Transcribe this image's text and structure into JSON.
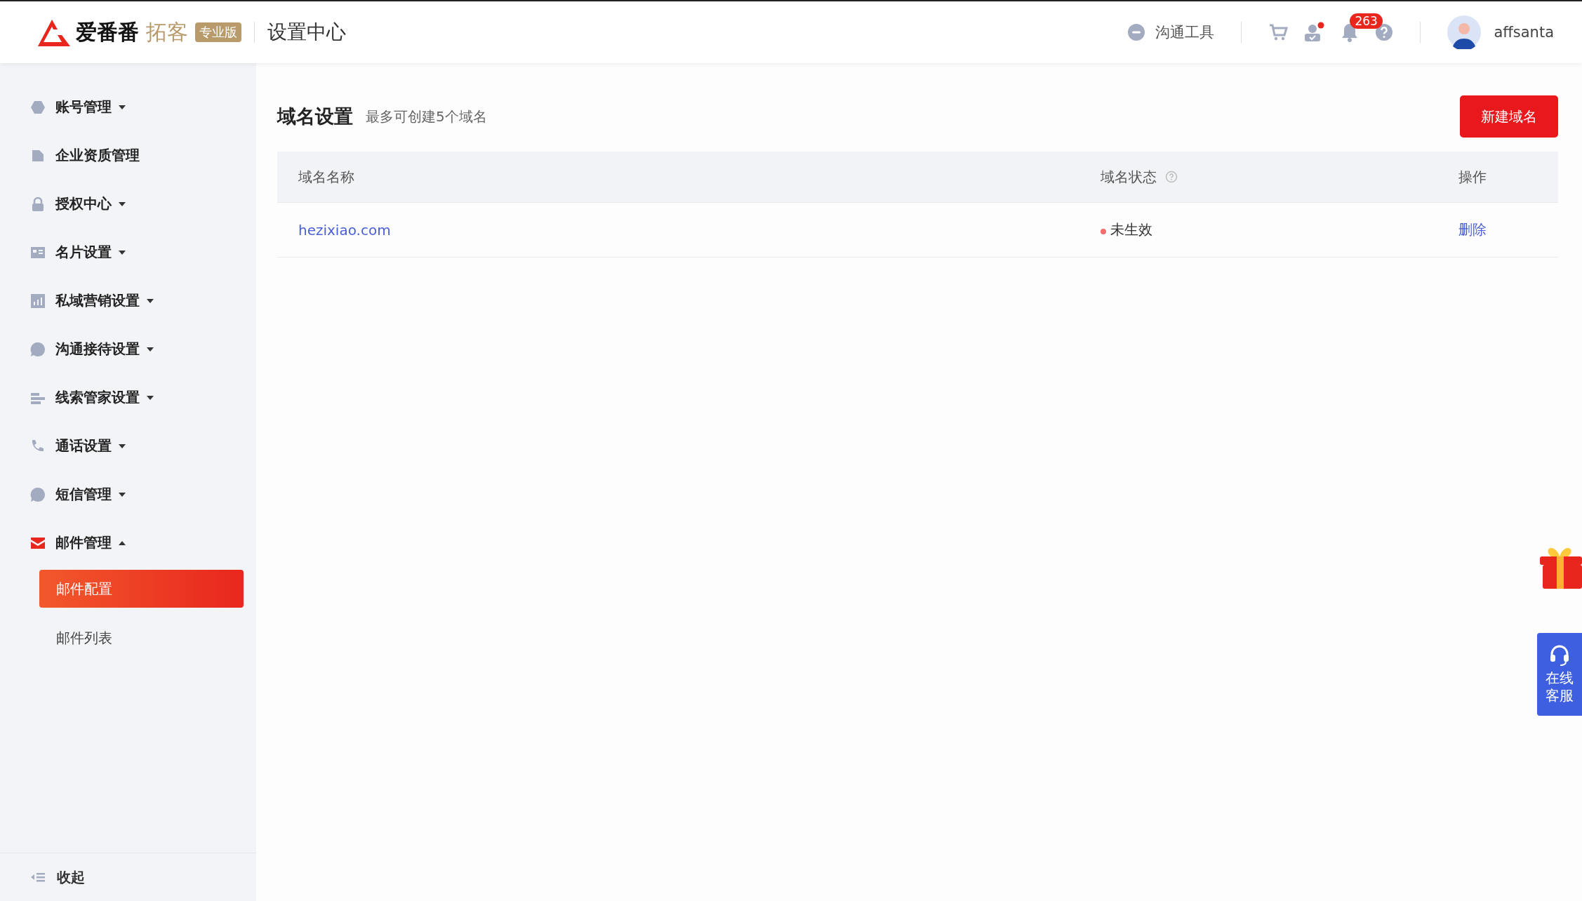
{
  "header": {
    "brand": "爱番番",
    "product": "拓客",
    "edition": "专业版",
    "section": "设置中心",
    "tools_label": "沟通工具",
    "contacts_dot": true,
    "notification_count": "263",
    "username": "affsanta"
  },
  "sidebar": {
    "items": [
      {
        "label": "账号管理",
        "kind": "group",
        "expanded": false
      },
      {
        "label": "企业资质管理",
        "kind": "link"
      },
      {
        "label": "授权中心",
        "kind": "group",
        "expanded": false
      },
      {
        "label": "名片设置",
        "kind": "group",
        "expanded": false
      },
      {
        "label": "私域营销设置",
        "kind": "group",
        "expanded": false
      },
      {
        "label": "沟通接待设置",
        "kind": "group",
        "expanded": false
      },
      {
        "label": "线索管家设置",
        "kind": "group",
        "expanded": false
      },
      {
        "label": "通话设置",
        "kind": "group",
        "expanded": false
      },
      {
        "label": "短信管理",
        "kind": "group",
        "expanded": false
      },
      {
        "label": "邮件管理",
        "kind": "group",
        "expanded": true,
        "children": [
          {
            "label": "邮件配置",
            "selected": true
          },
          {
            "label": "邮件列表",
            "selected": false
          }
        ]
      }
    ],
    "collapse_label": "收起"
  },
  "page": {
    "title": "域名设置",
    "subtitle": "最多可创建5个域名",
    "new_button": "新建域名"
  },
  "table": {
    "columns": [
      {
        "label": "域名名称",
        "help": false
      },
      {
        "label": "域名状态",
        "help": true
      },
      {
        "label": "操作",
        "help": false
      }
    ],
    "rows": [
      {
        "domain": "hezixiao.com",
        "status": "未生效",
        "color": "#f56c6c",
        "action": "删除"
      }
    ]
  },
  "floating": {
    "service_label": "在线客服"
  }
}
